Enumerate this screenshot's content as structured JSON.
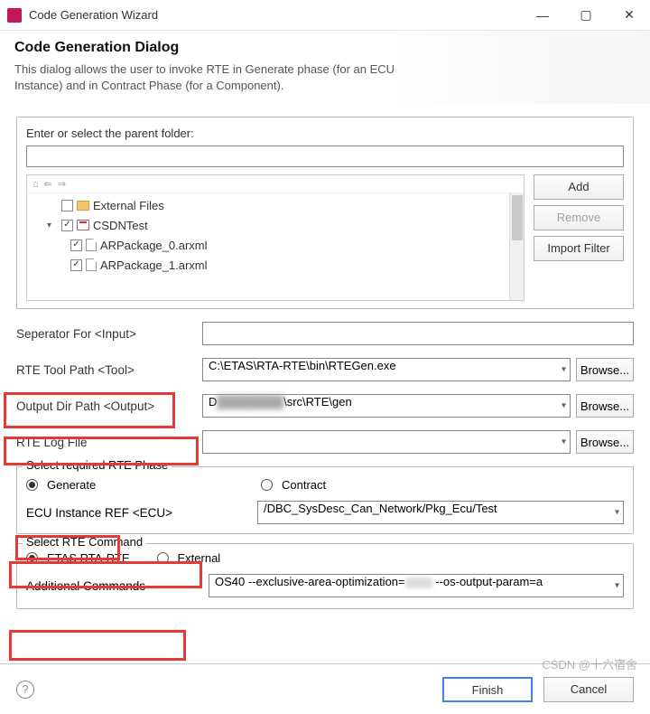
{
  "window": {
    "title": "Code Generation Wizard",
    "minimize": "—",
    "maximize": "▢",
    "close": "✕"
  },
  "banner": {
    "heading": "Code Generation Dialog",
    "description": "This dialog allows the user to invoke RTE in Generate phase (for an ECU Instance) and in Contract Phase (for a Component)."
  },
  "parent_folder": {
    "label": "Enter or select the parent folder:",
    "value": ""
  },
  "tree": {
    "items": [
      {
        "indent": 1,
        "checked": false,
        "expand": "",
        "icon": "folder",
        "label": "External Files"
      },
      {
        "indent": 1,
        "checked": true,
        "expand": "▾",
        "icon": "pkg",
        "label": "CSDNTest"
      },
      {
        "indent": 2,
        "checked": true,
        "expand": "",
        "icon": "file",
        "label": "ARPackage_0.arxml"
      },
      {
        "indent": 2,
        "checked": true,
        "expand": "",
        "icon": "file",
        "label": "ARPackage_1.arxml"
      }
    ]
  },
  "buttons": {
    "add": "Add",
    "remove": "Remove",
    "import_filter": "Import Filter"
  },
  "fields": {
    "separator_label": "Seperator For <Input>",
    "separator_value": "",
    "tool_label": "RTE Tool Path <Tool>",
    "tool_value": "C:\\ETAS\\RTA-RTE\\bin\\RTEGen.exe",
    "output_label": "Output Dir Path <Output>",
    "output_value_prefix": "D",
    "output_value_suffix": "\\src\\RTE\\gen",
    "log_label": "RTE Log File",
    "log_value": "",
    "browse": "Browse..."
  },
  "phase": {
    "legend": "Select required RTE Phase",
    "generate": "Generate",
    "contract": "Contract",
    "selected": "generate",
    "ecu_label": "ECU Instance REF <ECU>",
    "ecu_value": "/DBC_SysDesc_Can_Network/Pkg_Ecu/Test"
  },
  "command": {
    "legend": "Select RTE Command",
    "etas": "ETAS RTA-RTE",
    "external": "External",
    "selected": "etas",
    "additional_label": "Additional Commands",
    "additional_value_prefix": "OS40 --exclusive-area-optimization=",
    "additional_value_suffix": " --os-output-param=a"
  },
  "footer": {
    "help": "?",
    "finish": "Finish",
    "cancel": "Cancel"
  },
  "watermark": "CSDN @十六宿舍"
}
